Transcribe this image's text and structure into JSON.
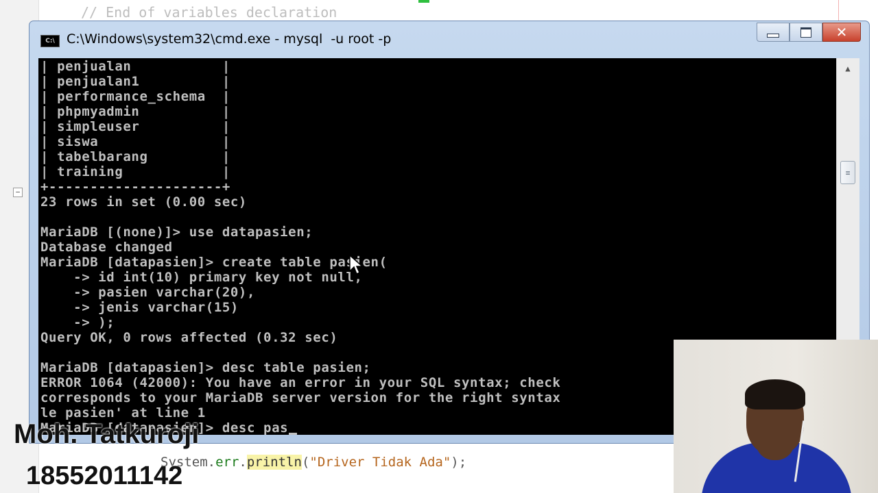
{
  "editor": {
    "top_line": "// End of variables declaration",
    "bottom_line": {
      "prefix": "System.",
      "err": "err",
      "dot": ".",
      "method": "println",
      "open": "(",
      "string": "\"Driver Tidak Ada\"",
      "close": ");"
    }
  },
  "window": {
    "title": "C:\\Windows\\system32\\cmd.exe - mysql  -u root -p",
    "icon_label": "C:\\",
    "buttons": {
      "minimize": "",
      "maximize": "",
      "close": "✕"
    }
  },
  "console": {
    "lines": [
      "| penjualan           |",
      "| penjualan1          |",
      "| performance_schema  |",
      "| phpmyadmin          |",
      "| simpleuser          |",
      "| siswa               |",
      "| tabelbarang         |",
      "| training            |",
      "+---------------------+",
      "23 rows in set (0.00 sec)",
      "",
      "MariaDB [(none)]> use datapasien;",
      "Database changed",
      "MariaDB [datapasien]> create table pasien(",
      "    -> id int(10) primary key not null,",
      "    -> pasien varchar(20),",
      "    -> jenis varchar(15)",
      "    -> );",
      "Query OK, 0 rows affected (0.32 sec)",
      "",
      "MariaDB [datapasien]> desc table pasien;",
      "ERROR 1064 (42000): You have an error in your SQL syntax; check",
      "corresponds to your MariaDB server version for the right syntax",
      "le pasien' at line 1",
      "MariaDB [datapasien]> desc pas"
    ]
  },
  "scrollbar": {
    "up_arrow": "▲",
    "thumb_grip": "≡"
  },
  "caption": {
    "name": "Moh. Tatkuroji",
    "id": "18552011142"
  },
  "colors": {
    "console_bg": "#000000",
    "console_text": "#c0c0c0",
    "titlebar": "#c6d9ef",
    "close_button": "#c8412c"
  }
}
